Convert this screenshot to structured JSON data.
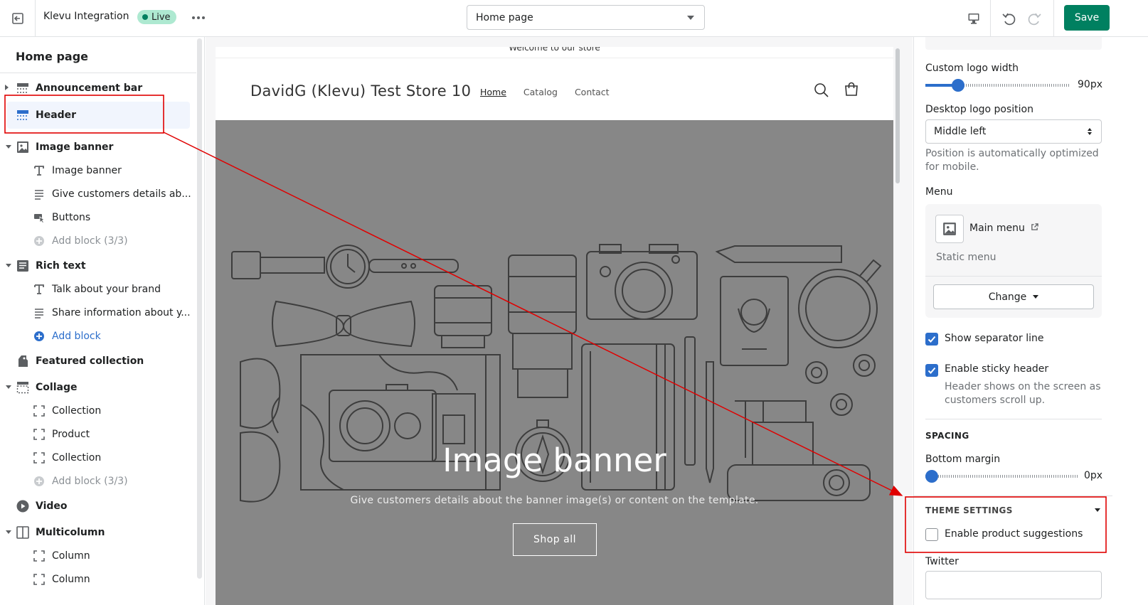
{
  "topbar": {
    "app_title": "Klevu Integration",
    "status_badge": "Live",
    "page_select": "Home page",
    "save_label": "Save"
  },
  "sidebar": {
    "title": "Home page",
    "rows": [
      {
        "kind": "section",
        "label": "Announcement bar",
        "icon": "layout-header-icon",
        "arrow": "right"
      },
      {
        "kind": "section",
        "label": "Header",
        "icon": "layout-header-icon",
        "selected": true
      },
      {
        "kind": "section",
        "label": "Image banner",
        "icon": "image-icon",
        "arrow": "down"
      },
      {
        "kind": "block",
        "label": "Image banner",
        "icon": "text-icon"
      },
      {
        "kind": "block",
        "label": "Give customers details ab...",
        "icon": "paragraph-icon"
      },
      {
        "kind": "block",
        "label": "Buttons",
        "icon": "button-icon"
      },
      {
        "kind": "block",
        "label": "Add block (3/3)",
        "icon": "add-icon",
        "muted": true
      },
      {
        "kind": "section",
        "label": "Rich text",
        "icon": "paragraph-box-icon",
        "arrow": "down"
      },
      {
        "kind": "block",
        "label": "Talk about your brand",
        "icon": "text-icon"
      },
      {
        "kind": "block",
        "label": "Share information about y...",
        "icon": "paragraph-icon"
      },
      {
        "kind": "block",
        "label": "Add block",
        "icon": "add-icon",
        "blue": true
      },
      {
        "kind": "section",
        "label": "Featured collection",
        "icon": "tag-icon"
      },
      {
        "kind": "section",
        "label": "Collage",
        "icon": "collage-icon",
        "arrow": "down"
      },
      {
        "kind": "block",
        "label": "Collection",
        "icon": "dashed-frame-icon"
      },
      {
        "kind": "block",
        "label": "Product",
        "icon": "dashed-frame-icon"
      },
      {
        "kind": "block",
        "label": "Collection",
        "icon": "dashed-frame-icon"
      },
      {
        "kind": "block",
        "label": "Add block (3/3)",
        "icon": "add-icon",
        "muted": true
      },
      {
        "kind": "section",
        "label": "Video",
        "icon": "play-icon"
      },
      {
        "kind": "section",
        "label": "Multicolumn",
        "icon": "columns-icon",
        "arrow": "down"
      },
      {
        "kind": "block",
        "label": "Column",
        "icon": "dashed-frame-icon"
      },
      {
        "kind": "block",
        "label": "Column",
        "icon": "dashed-frame-icon"
      }
    ]
  },
  "preview": {
    "announcement": "Welcome to our store",
    "store_name": "DavidG (Klevu) Test Store 10",
    "nav": [
      "Home",
      "Catalog",
      "Contact"
    ],
    "banner_title": "Image banner",
    "banner_subtitle": "Give customers details about the banner image(s) or content on the template.",
    "banner_button": "Shop all"
  },
  "settings": {
    "logo_width_label": "Custom logo width",
    "logo_width_value": "90px",
    "logo_width_fraction": 0.23,
    "logo_position_label": "Desktop logo position",
    "logo_position_value": "Middle left",
    "logo_position_help": [
      "Position is automatically optimized",
      "for mobile."
    ],
    "menu_label": "Menu",
    "menu_name": "Main menu",
    "menu_type": "Static menu",
    "change_label": "Change",
    "separator_label": "Show separator line",
    "separator_checked": true,
    "sticky_label": "Enable sticky header",
    "sticky_checked": true,
    "sticky_help": [
      "Header shows on the screen as",
      "customers scroll up."
    ],
    "spacing_heading": "SPACING",
    "bottom_margin_label": "Bottom margin",
    "bottom_margin_value": "0px",
    "bottom_margin_fraction": 0,
    "theme_heading": "THEME SETTINGS",
    "suggestions_label": "Enable product suggestions",
    "suggestions_checked": false,
    "twitter_label": "Twitter"
  },
  "colors": {
    "primary": "#008060",
    "interactive": "#2c6ecb",
    "annotation": "#e00000",
    "banner_bg": "#878787"
  }
}
